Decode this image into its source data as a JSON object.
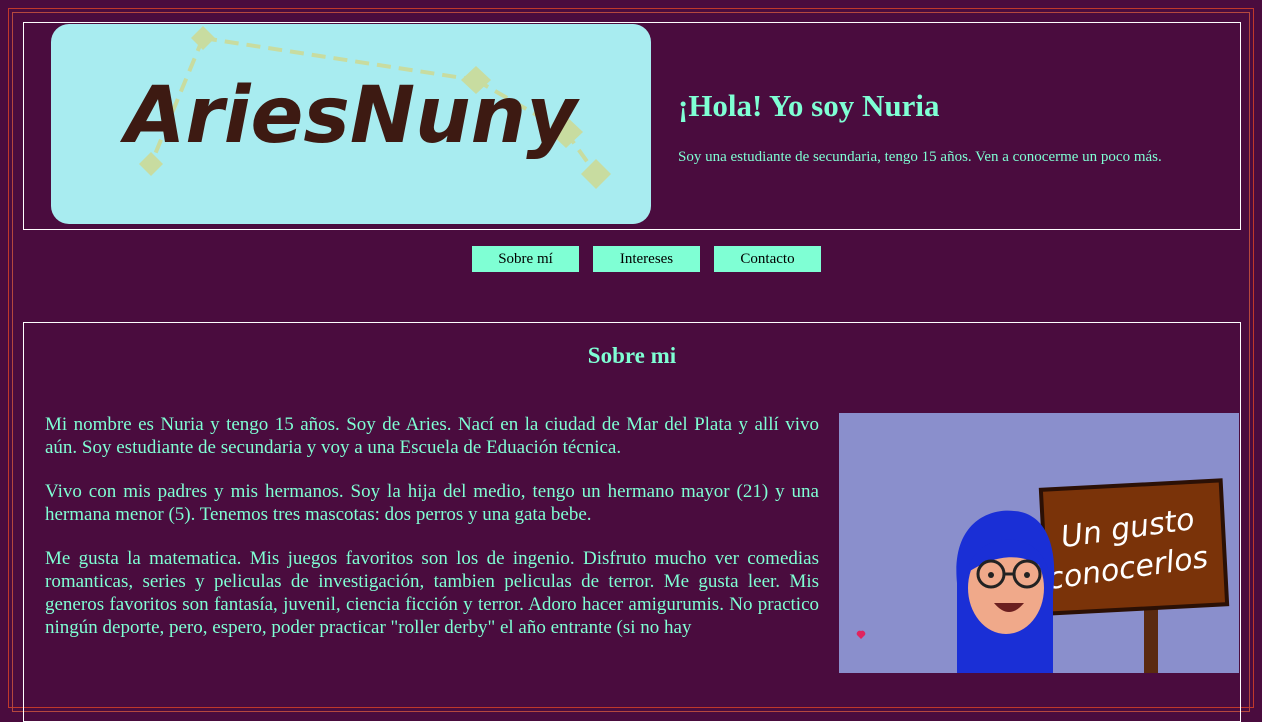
{
  "header": {
    "logo_text": "AriesNuny",
    "greeting": "¡Hola! Yo soy Nuria",
    "intro": "Soy una estudiante de secundaria, tengo 15 años. Ven a conocerme un poco más."
  },
  "nav": {
    "items": [
      {
        "label": "Sobre mí"
      },
      {
        "label": "Intereses"
      },
      {
        "label": "Contacto"
      }
    ]
  },
  "about": {
    "title": "Sobre mi",
    "paragraphs": [
      "Mi nombre es Nuria y tengo 15 años. Soy de Aries. Nací en la ciudad de Mar del Plata y allí vivo aún. Soy estudiante de secundaria y voy a una Escuela de Eduación técnica.",
      "Vivo con mis padres y mis hermanos. Soy la hija del medio, tengo un hermano mayor (21) y una hermana menor (5). Tenemos tres mascotas: dos perros y una gata bebe.",
      "Me gusta la matematica. Mis juegos favoritos son los de ingenio. Disfruto mucho ver comedias romanticas, series y peliculas de investigación, tambien peliculas de terror. Me gusta leer. Mis generos favoritos son fantasía, juvenil, ciencia ficción y terror. Adoro hacer amigurumis. No practico ningún deporte, pero, espero, poder practicar \"roller derby\" el año entrante (si no hay"
    ],
    "image_sign_line1": "Un gusto",
    "image_sign_line2": "conocerlos"
  },
  "colors": {
    "background": "#4a0c3e",
    "accent": "#7fffd4",
    "logo_bg": "#a8ecf0",
    "portrait_bg": "#8a8fcc",
    "sign_brown": "#7a3309"
  }
}
